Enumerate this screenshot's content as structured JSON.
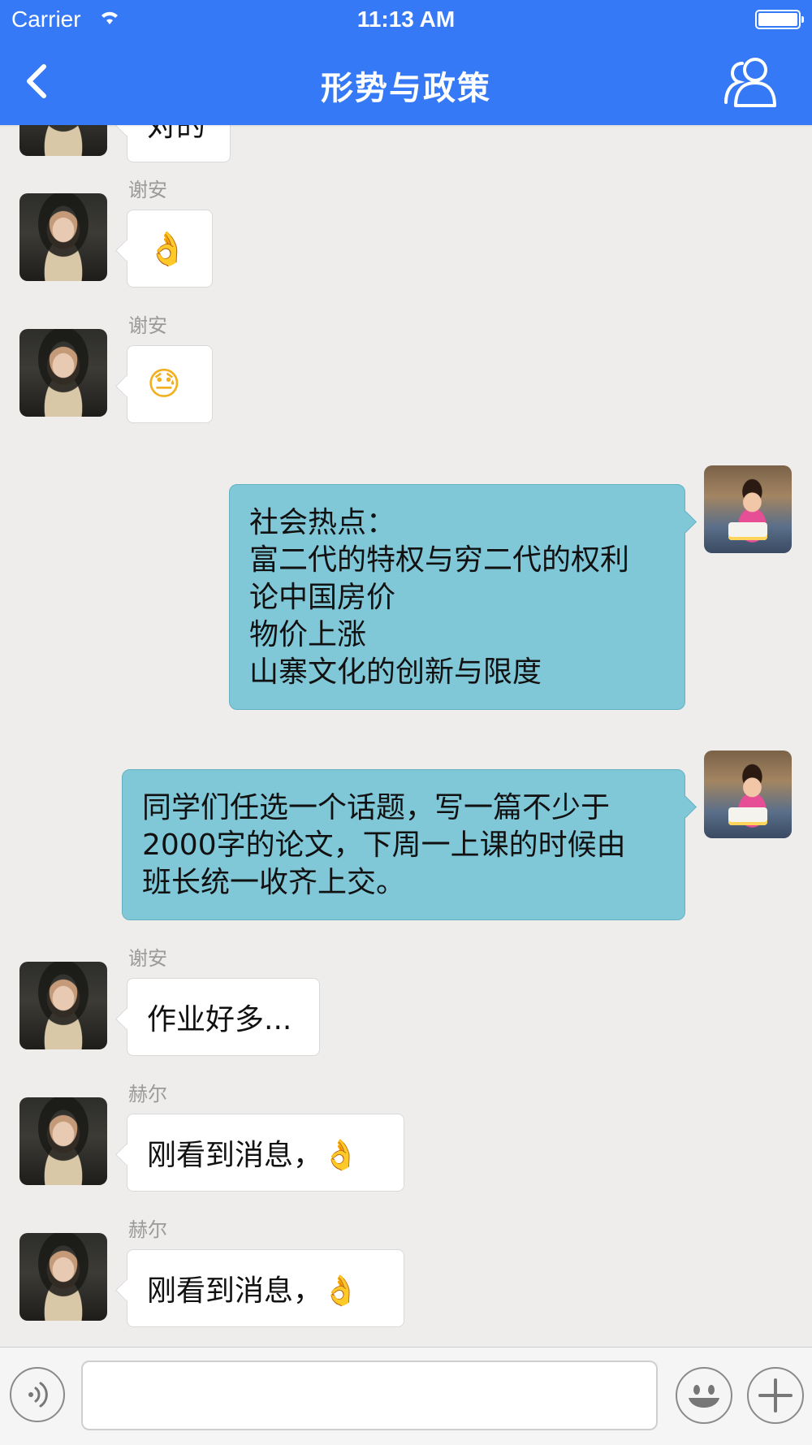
{
  "status_bar": {
    "carrier": "Carrier",
    "time": "11:13 AM"
  },
  "nav": {
    "title": "形势与政策",
    "back_icon": "chevron-left-icon",
    "members_icon": "group-members-icon"
  },
  "messages": {
    "partial_top": {
      "text": "对的"
    },
    "m1": {
      "sender": "谢安",
      "text": "👌"
    },
    "m2": {
      "sender": "谢安",
      "text": "😓"
    },
    "m3": {
      "lines": [
        "社会热点：",
        "富二代的特权与穷二代的权利",
        "论中国房价",
        "物价上涨",
        "山寨文化的创新与限度"
      ]
    },
    "m4": {
      "lines": [
        "同学们任选一个话题，写一篇不少于",
        "2000字的论文，下周一上课的时候由",
        "班长统一收齐上交。"
      ]
    },
    "m5": {
      "sender": "谢安",
      "text": "作业好多..."
    },
    "m6": {
      "sender": "赫尔",
      "text": "刚看到消息，👌"
    },
    "m7": {
      "sender": "赫尔",
      "text": "刚看到消息，👌"
    }
  },
  "input_bar": {
    "placeholder": "",
    "voice_icon": "voice-icon",
    "emoji_icon": "emoji-icon",
    "plus_icon": "plus-icon"
  },
  "colors": {
    "header": "#3579f6",
    "outgoing_bubble": "#80c8d8",
    "background": "#efedec"
  }
}
